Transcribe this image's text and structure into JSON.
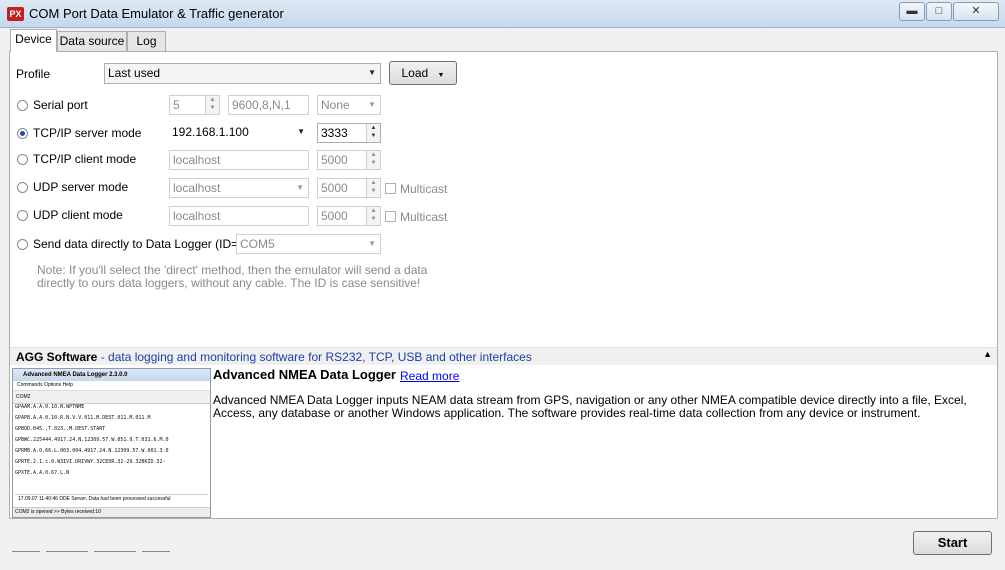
{
  "window": {
    "app_icon": "PX",
    "title": "COM Port Data Emulator & Traffic generator",
    "minimize_icon": "minimize-icon",
    "maximize_icon": "maximize-icon",
    "close_icon": "close-icon"
  },
  "tabs": [
    {
      "label": "Device",
      "active": true
    },
    {
      "label": "Data source",
      "active": false
    },
    {
      "label": "Log",
      "active": false
    }
  ],
  "profile": {
    "label": "Profile",
    "value": "Last used",
    "load_label": "Load"
  },
  "modes": {
    "serial": {
      "label": "Serial port",
      "port": "5",
      "settings": "9600,8,N,1",
      "flow": "None",
      "selected": false
    },
    "tcp_server": {
      "label": "TCP/IP server mode",
      "host": "192.168.1.100",
      "port": "3333",
      "selected": true
    },
    "tcp_client": {
      "label": "TCP/IP client mode",
      "host": "localhost",
      "port": "5000",
      "selected": false
    },
    "udp_server": {
      "label": "UDP server mode",
      "host": "localhost",
      "port": "5000",
      "multicast": "Multicast",
      "selected": false
    },
    "udp_client": {
      "label": "UDP client mode",
      "host": "localhost",
      "port": "5000",
      "multicast": "Multicast",
      "selected": false
    },
    "direct": {
      "label": "Send data directly to Data Logger (ID=)",
      "id": "COM5",
      "selected": false
    }
  },
  "note": "Note: If you'll select the 'direct' method, then the emulator will send a data directly to ours data loggers, without any cable. The ID is case sensitive!",
  "agg": {
    "name": "AGG Software",
    "tagline": " - data logging and monitoring software for RS232, TCP, USB and other interfaces"
  },
  "product": {
    "title": "Advanced NMEA Data Logger",
    "read_more": "Read more",
    "description": "Advanced NMEA Data Logger inputs NEAM data stream from GPS, navigation or any other NMEA compatible device directly into a file, Excel, Access, any database or another Windows application. The software provides real-time data collection from any device or instrument."
  },
  "thumbnail": {
    "title": "Advanced NMEA Data Logger 2.3.0.0",
    "menu": "Commands  Options  Help",
    "toolbar": "COM2",
    "lines": [
      "GPAAM.A.A.0.10.N.WPTNME",
      "GPAPB.A.A.0.10.R.N.V.V.011.M.DEST.011.M.011.M",
      "GPBOD.045.,T.023.,M.DEST.START",
      "GPBWC.225444.4917.24.N.12309.57.W.051.9.T.031.6.M.0",
      "GPRMB.A.0.66.L.003.004.4917.24.N.12309.57.W.001.3.0",
      "GPRTE.2.1.c.0.W3IVI.DRIVWY.32CEDR.32-29.32BKID.32-",
      "GPXTE.A.A.0.67.L.N"
    ],
    "message": "17.09.07 11:40:46 DDE Server. Data had been processed successful",
    "status": "COM2 is opened  >> Bytes received:10"
  },
  "start_label": "Start"
}
